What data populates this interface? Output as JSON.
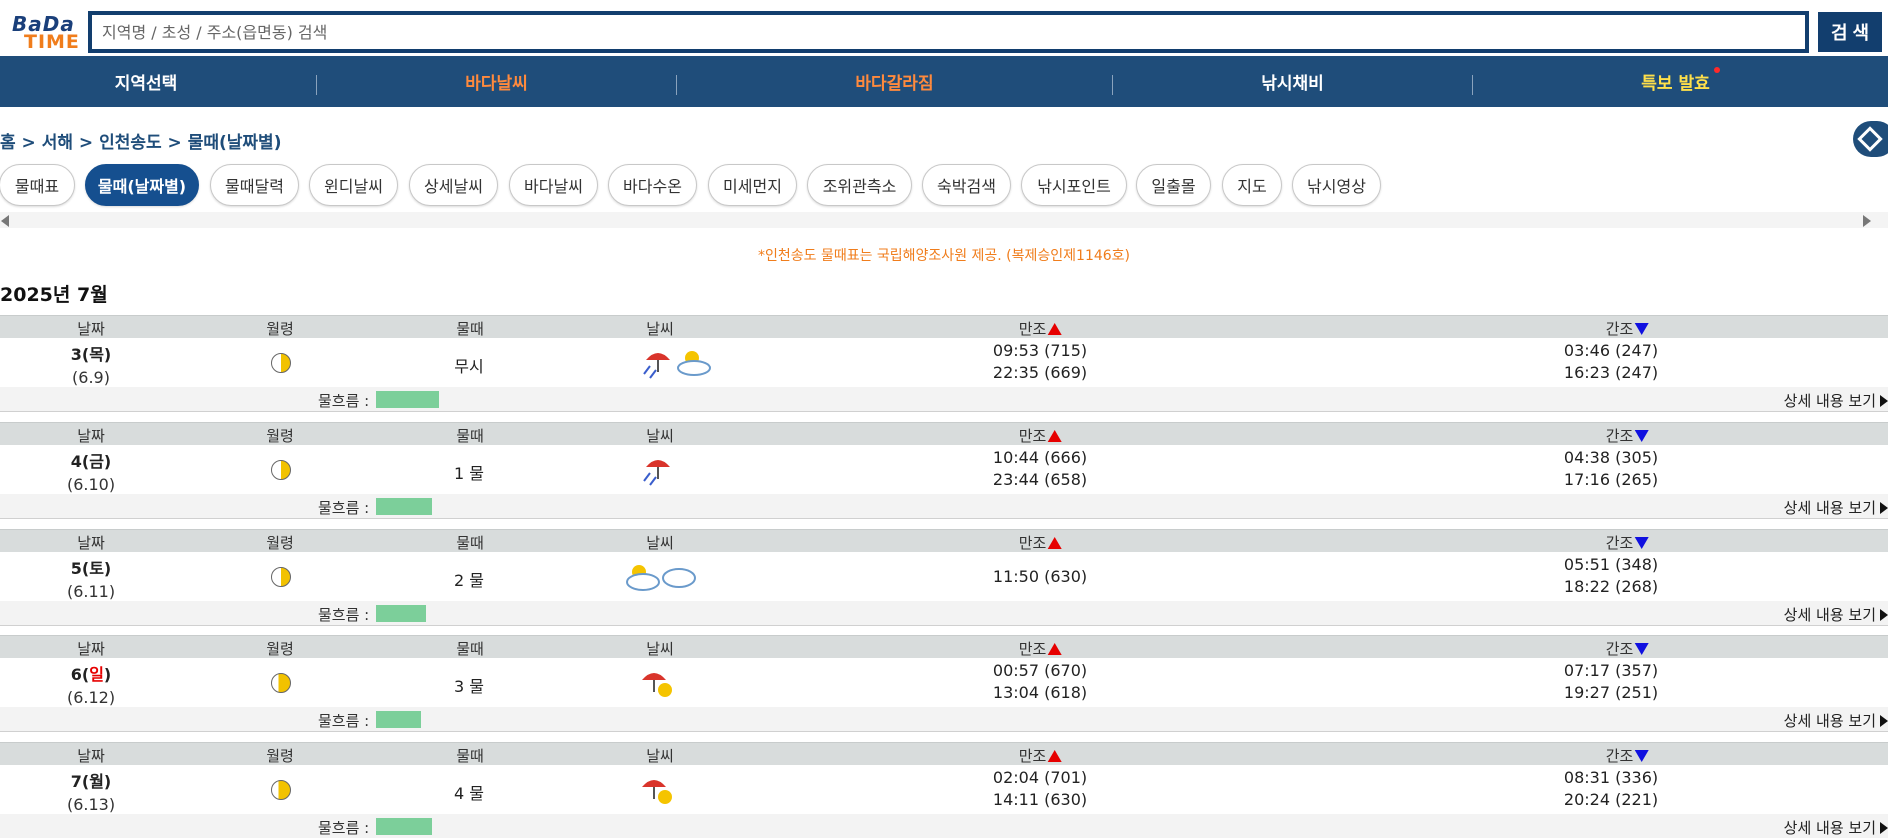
{
  "logo": {
    "line1": "BaDa",
    "line2": "TIME"
  },
  "search": {
    "placeholder": "지역명 / 초성 / 주소(읍면동) 검색",
    "value": "",
    "button_label": "검 색"
  },
  "nav": {
    "items": [
      {
        "label": "지역선택",
        "color": "#ffffff"
      },
      {
        "label": "바다날씨",
        "color": "#ff8a3d"
      },
      {
        "label": "바다갈라짐",
        "color": "#ff8a3d"
      },
      {
        "label": "낚시채비",
        "color": "#ffffff"
      },
      {
        "label": "특보 발효",
        "color": "#ffe04a"
      }
    ]
  },
  "breadcrumb": "홈 > 서해 > 인천송도 > 물때(날짜별)",
  "tabs": [
    "물때표",
    "물때(날짜별)",
    "물때달력",
    "윈디날씨",
    "상세날씨",
    "바다날씨",
    "바다수온",
    "미세먼지",
    "조위관측소",
    "숙박검색",
    "낚시포인트",
    "일출몰",
    "지도",
    "낚시영상"
  ],
  "active_tab": "물때(날짜별)",
  "notice": "*인천송도 물때표는 국립해양조사원 제공. (복제승인제1146호)",
  "month_title": "2025년 7월",
  "headers": {
    "date": "날짜",
    "moon": "월령",
    "tide": "물때",
    "weather": "날씨",
    "high": "만조",
    "low": "간조"
  },
  "flow_label": "물흐름 :",
  "detail_label": "상세 내용 보기",
  "days": [
    {
      "date": "3",
      "dow": "(목)",
      "lunar": "(6.9)",
      "tide": "무시",
      "weather": "rain, partly-cloudy",
      "high": [
        "09:53 (715)",
        "22:35 (669)"
      ],
      "low": [
        "03:46 (247)",
        "16:23 (247)"
      ],
      "flow": 0.35
    },
    {
      "date": "4",
      "dow": "(금)",
      "lunar": "(6.10)",
      "tide": "1 물",
      "weather": "rain",
      "high": [
        "10:44 (666)",
        "23:44 (658)"
      ],
      "low": [
        "04:38 (305)",
        "17:16 (265)"
      ],
      "flow": 0.31
    },
    {
      "date": "5",
      "dow": "(토)",
      "lunar": "(6.11)",
      "tide": "2 물",
      "weather": "partly-cloudy, cloudy",
      "high": [
        "11:50 (630)"
      ],
      "low": [
        "05:51 (348)",
        "18:22 (268)"
      ],
      "flow": 0.28
    },
    {
      "date": "6",
      "dow_open": "(",
      "dow_day": "일",
      "dow_close": ")",
      "lunar": "(6.12)",
      "tide": "3 물",
      "weather": "rain-sun",
      "high": [
        "00:57 (670)",
        "13:04 (618)"
      ],
      "low": [
        "07:17 (357)",
        "19:27 (251)"
      ],
      "flow": 0.25
    },
    {
      "date": "7",
      "dow": "(월)",
      "lunar": "(6.13)",
      "tide": "4 물",
      "weather": "rain-sun",
      "high": [
        "02:04 (701)",
        "14:11 (630)"
      ],
      "low": [
        "08:31 (336)",
        "20:24 (221)"
      ],
      "flow": 0.31
    }
  ]
}
